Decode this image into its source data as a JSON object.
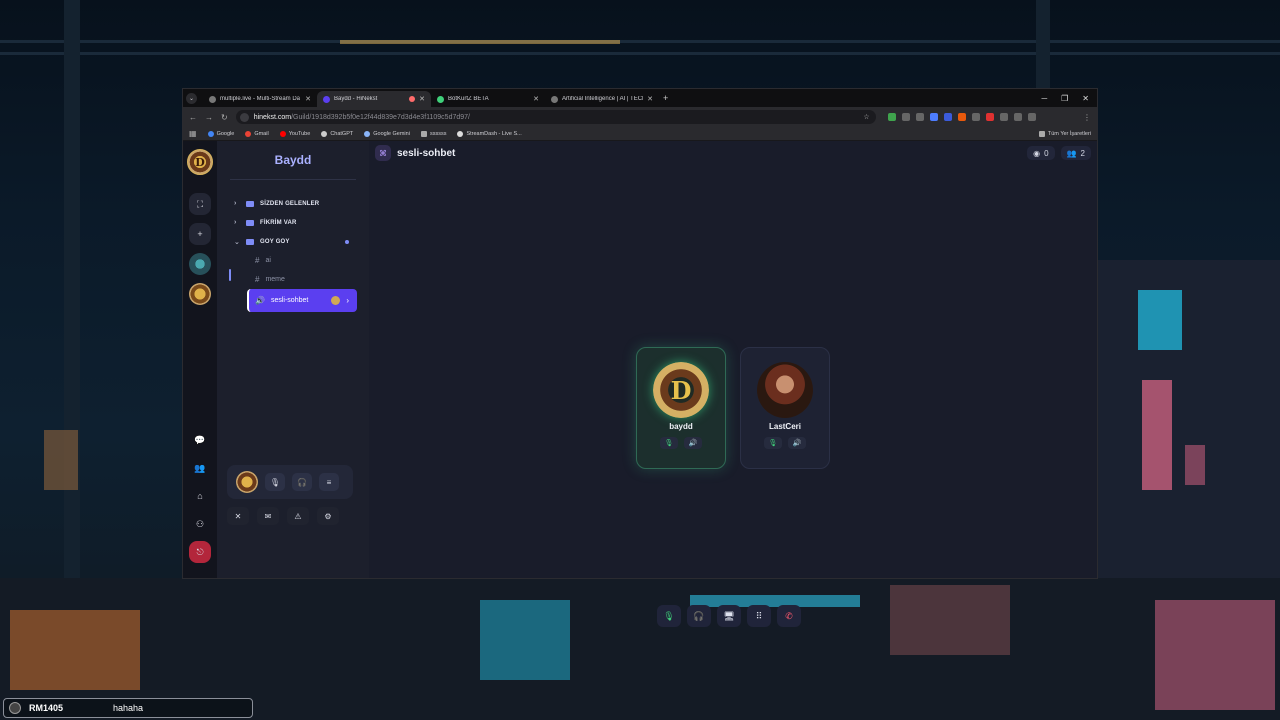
{
  "browser": {
    "tabs": [
      {
        "title": "multiple.live - Multi-Stream Da",
        "active": false
      },
      {
        "title": "Baydd - HiNekst",
        "active": true
      },
      {
        "title": "BotKurtZ BETA",
        "active": false
      },
      {
        "title": "Artificial Intelligence | AI | TECH",
        "active": false
      }
    ],
    "url_host": "hinekst.com",
    "url_path": "/Guild/1918d392b5f0e12f44d839e7d3d4e3f1109c5d7d97/",
    "bookmarks": [
      "Google",
      "Gmail",
      "YouTube",
      "ChatGPT",
      "Google Gemini",
      "ssssss",
      "StreamDash - Live S..."
    ],
    "all_bookmarks_label": "Tüm Yer İşaretleri"
  },
  "server": {
    "name": "Baydd",
    "categories": [
      {
        "label": "SİZDEN GELENLER",
        "expanded": false
      },
      {
        "label": "FİKRİM VAR",
        "expanded": false
      },
      {
        "label": "GOY GOY",
        "expanded": true
      }
    ],
    "text_channels": [
      "ai",
      "meme"
    ],
    "voice_channel": "sesli-sohbet"
  },
  "main": {
    "channel_name": "sesli-sohbet",
    "view_count": "0",
    "member_count": "2",
    "participants": [
      {
        "name": "baydd",
        "speaking": true,
        "initial": "D"
      },
      {
        "name": "LastCeri",
        "speaking": false,
        "initial": ""
      }
    ]
  },
  "chat_overlay": {
    "username": "RM1405",
    "message": "hahaha"
  },
  "colors": {
    "accent": "#5b3ff0",
    "speaking": "#3fd07a",
    "danger": "#b3263b"
  }
}
